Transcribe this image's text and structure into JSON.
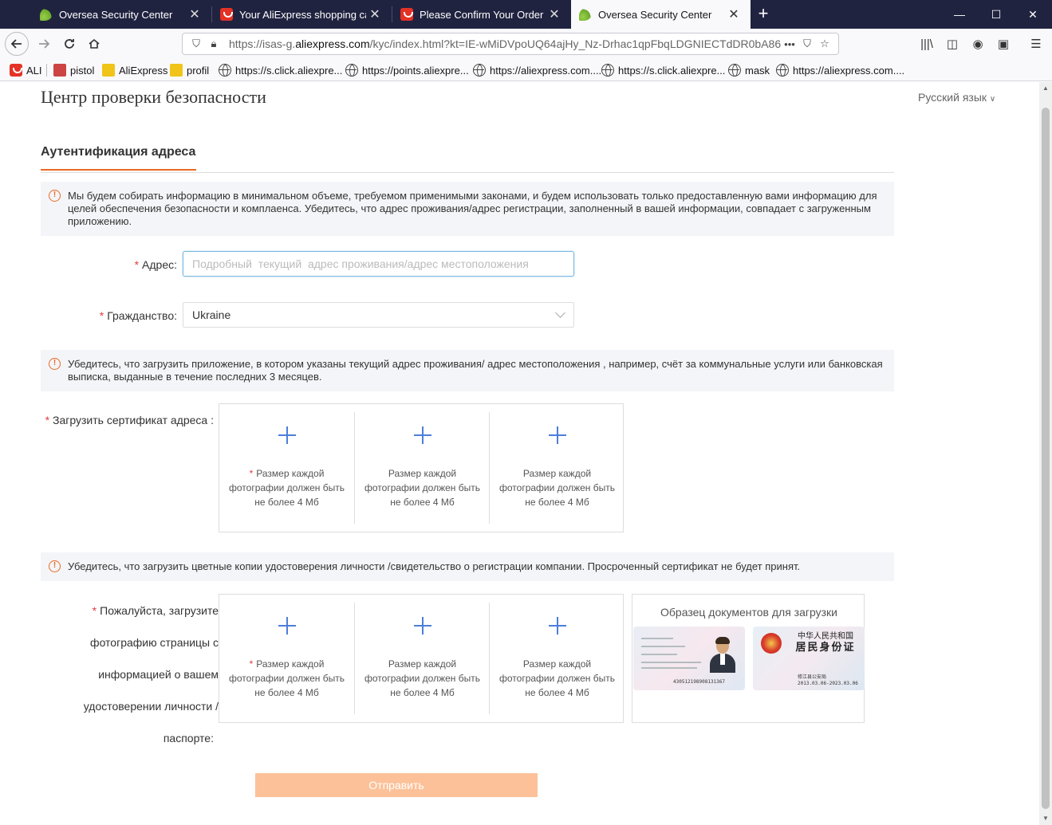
{
  "browser": {
    "tabs": [
      {
        "title": "Oversea Security Center",
        "active": false
      },
      {
        "title": "Your AliExpress shopping cart - ",
        "active": false
      },
      {
        "title": "Please Confirm Your Order - Ali",
        "active": false
      },
      {
        "title": "Oversea Security Center",
        "active": true
      }
    ],
    "new_tab": "+",
    "window_buttons": {
      "minimize": "—",
      "maximize": "☐",
      "close": "✕"
    },
    "url_prefix": "https://isas-g.",
    "url_domain": "aliexpress.com",
    "url_rest": "/kyc/index.html?kt=IE-wMiDVpoUQ64ajHy_Nz-Drhac1qpFbqLDGNIECTdDR0bA86",
    "bookmarks": [
      "ALI",
      "pistol",
      "AliExpress",
      "profil",
      "https://s.click.aliexpre...",
      "https://points.aliexpre...",
      "https://aliexpress.com....",
      "https://s.click.aliexpre...",
      "mask",
      "https://aliexpress.com...."
    ]
  },
  "page": {
    "title": "Центр проверки безопасности",
    "language": "Русский язык",
    "section_title": "Аутентификация адреса",
    "notice1": "Мы будем собирать информацию в минимальном объеме, требуемом применимыми законами, и будем использовать только предоставленную вами информацию для целей обеспечения безопасности и комплаенса. Убедитесь, что адрес проживания/адрес регистрации, заполненный в вашей информации, совпадает с загруженным приложению.",
    "address_label": "Адрес:",
    "address_value": "",
    "address_placeholder": "Подробный  текущий  адрес проживания/адрес местоположения",
    "citizenship_label": "Гражданство:",
    "citizenship_value": "Ukraine",
    "notice2": "Убедитесь, что загрузить приложение, в котором указаны текущий адрес проживания/ адрес местоположения , например, счёт за коммунальные услуги или банковская выписка, выданные в течение последних 3 месяцев.",
    "upload_cert_label": "Загрузить сертификат адреса :",
    "upload_hint": "Размер каждой фотографии должен быть не более 4 Мб",
    "notice3": "Убедитесь, что загрузить цветные копии удостоверения личности /свидетельство о регистрации компании. Просроченный сертификат не будет принят.",
    "id_label_lines": [
      "Пожалуйста, загрузите",
      "фотографию страницы с",
      "информацией о вашем",
      "удостоверении личности /",
      "паспорте:"
    ],
    "sample_title": "Образец документов для загрузки",
    "sample_card": {
      "country": "中华人民共和国",
      "doc_name": "居民身份证",
      "id_number": "430512198908131367",
      "issuer": "修江县公安局",
      "validity": "2013.03.06-2023.03.06"
    },
    "submit_label": "Отправить"
  },
  "colors": {
    "accent": "#e96a22",
    "required": "#e4393c",
    "upload_plus": "#4c7ed9",
    "submit_bg": "#fcc199",
    "tabbar_bg": "#202340"
  }
}
